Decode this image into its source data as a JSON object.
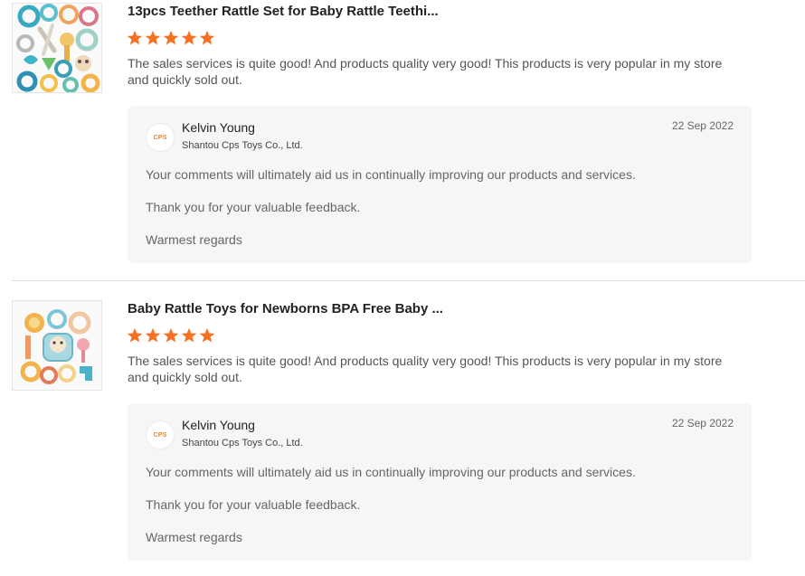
{
  "reviews": [
    {
      "title": "13pcs Teether Rattle Set for Baby Rattle Teethi...",
      "rating": 5,
      "comment": "The sales services is quite good! And products quality very good! This products is very popular in my store and quickly sold out.",
      "reply": {
        "avatar_text": "CPS",
        "name": "Kelvin Young",
        "company": "Shantou Cps Toys Co., Ltd.",
        "date": "22 Sep 2022",
        "line1": "Your comments will ultimately aid us in continually improving our products and services.",
        "line2": "Thank you for your valuable feedback.",
        "line3": "Warmest regards"
      }
    },
    {
      "title": "Baby Rattle Toys for Newborns BPA Free Baby ...",
      "rating": 5,
      "comment": "The sales services is quite good! And products quality very good! This products is very popular in my store and quickly sold out.",
      "reply": {
        "avatar_text": "CPS",
        "name": "Kelvin Young",
        "company": "Shantou Cps Toys Co., Ltd.",
        "date": "22 Sep 2022",
        "line1": "Your comments will ultimately aid us in continually improving our products and services.",
        "line2": "Thank you for your valuable feedback.",
        "line3": "Warmest regards"
      }
    }
  ],
  "colors": {
    "star": "#f57224",
    "reply_bg": "#f5f6f7"
  }
}
